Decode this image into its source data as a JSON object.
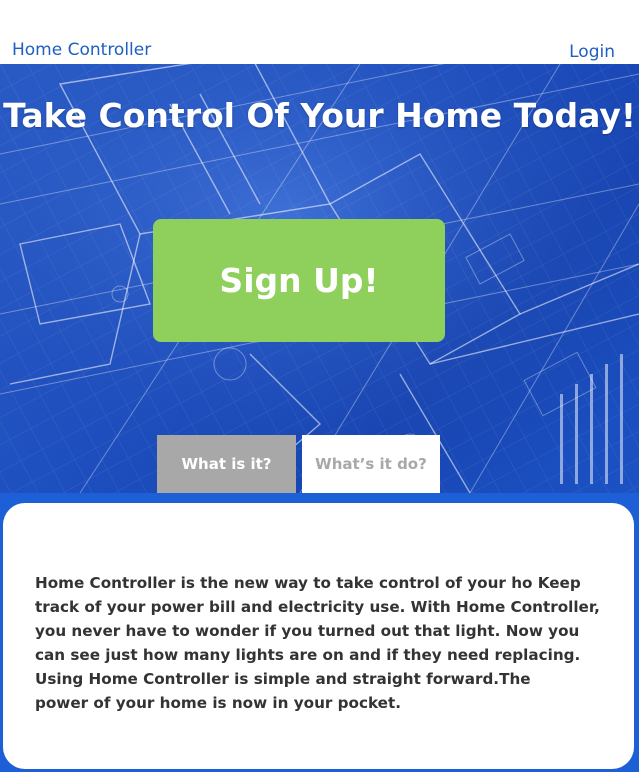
{
  "header": {
    "brand": "Home Controller",
    "login": "Login"
  },
  "hero": {
    "title": "Take Control Of Your Home Today!",
    "signup_label": "Sign Up!",
    "background": "blueprint"
  },
  "tabs": [
    {
      "label": "What is it?",
      "active": true
    },
    {
      "label": "What’s it do?",
      "active": false
    }
  ],
  "content": {
    "text": "Home Controller is the new way to take control of your ho Keep\ntrack of your power bill and electricity use. With Home Controller,\nyou never have to wonder if you turned out that light. Now you\ncan see just how many lights are on and if they need replacing.\nUsing Home Controller is simple and straight forward.The\npower of your home is now in your pocket."
  },
  "colors": {
    "link": "#1f5fbf",
    "hero_blue": "#1e4fbf",
    "signup_green": "#8fcf5c",
    "tab_active": "#a8a8a8",
    "content_bg": "#1c5fd6",
    "text": "#333333"
  }
}
